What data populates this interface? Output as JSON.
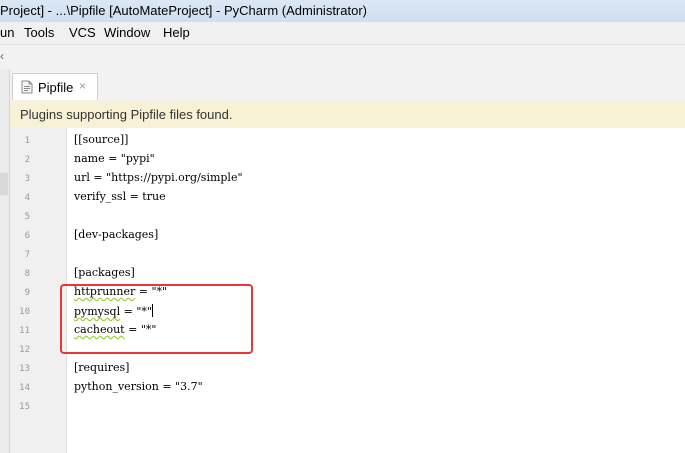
{
  "window": {
    "title": "Project] - ...\\Pipfile [AutoMateProject] - PyCharm (Administrator)"
  },
  "menu": {
    "items": [
      "un",
      "Tools",
      "VCS",
      "Window",
      "Help"
    ]
  },
  "tabs": [
    {
      "label": "Pipfile",
      "close": "×",
      "icon": "pipfile-icon",
      "active": true
    }
  ],
  "notification": {
    "text": "Plugins supporting Pipfile files found."
  },
  "editor": {
    "caret_line": 10,
    "lines": [
      {
        "number": "1",
        "text": "[[source]]"
      },
      {
        "number": "2",
        "text": "name = \"pypi\""
      },
      {
        "number": "3",
        "text": "url = \"https://pypi.org/simple\""
      },
      {
        "number": "4",
        "text": "verify_ssl = true"
      },
      {
        "number": "5",
        "text": ""
      },
      {
        "number": "6",
        "text": "[dev-packages]"
      },
      {
        "number": "7",
        "text": ""
      },
      {
        "number": "8",
        "text": "[packages]"
      },
      {
        "number": "9",
        "text": "httprunner = \"*\""
      },
      {
        "number": "10",
        "text": "pymysql = \"*\""
      },
      {
        "number": "11",
        "text": "cacheout = \"*\""
      },
      {
        "number": "12",
        "text": ""
      },
      {
        "number": "13",
        "text": "[requires]"
      },
      {
        "number": "14",
        "text": "python_version = \"3.7\""
      },
      {
        "number": "15",
        "text": ""
      }
    ]
  },
  "annotation": {
    "color": "#e8363b"
  },
  "colors": {
    "notice_background": "#f7f1d5",
    "gutter_background": "#f0f0f0",
    "caret_row_background": "#fcfae6"
  }
}
